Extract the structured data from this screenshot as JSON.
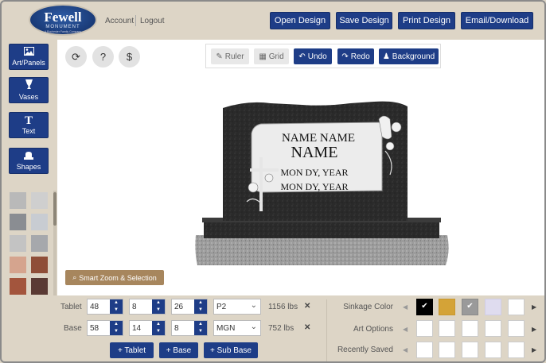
{
  "header": {
    "logo": {
      "line1": "Fewell",
      "line2": "MONUMENT",
      "line3": "A Rochester Family Company"
    },
    "links": {
      "account": "Account",
      "logout": "Logout"
    },
    "buttons": {
      "open": "Open Design",
      "save": "Save Design",
      "print": "Print Design",
      "email": "Email/Download"
    }
  },
  "leftbar": {
    "tools": [
      {
        "label": "Art/Panels",
        "icon": "image-icon"
      },
      {
        "label": "Vases",
        "icon": "vase-icon"
      },
      {
        "label": "Text",
        "icon": "text-icon"
      },
      {
        "label": "Shapes",
        "icon": "shapes-icon"
      }
    ],
    "swatch_colors": [
      "#b9b9b9",
      "#cfcfcf",
      "#8a8d92",
      "#c8ccd2",
      "#c3c3c3",
      "#a6a8ac",
      "#b56b54",
      "#8f4e38",
      "#a3553d",
      "#5a4a44"
    ]
  },
  "canvas": {
    "circle_buttons": {
      "refresh": "⟳",
      "help": "?",
      "price": "$"
    },
    "toolbar": {
      "ruler": "Ruler",
      "grid": "Grid",
      "undo": "Undo",
      "redo": "Redo",
      "background": "Background"
    },
    "monument": {
      "name1": "NAME NAME",
      "name2": "NAME",
      "date1": "MON DY, YEAR",
      "date2": "MON DY, YEAR"
    },
    "smart_zoom": "Smart Zoom & Selection"
  },
  "bottom": {
    "tablet": {
      "label": "Tablet",
      "w": "48",
      "d": "8",
      "h": "26",
      "material": "P2",
      "weight": "1156 lbs"
    },
    "base": {
      "label": "Base",
      "w": "58",
      "d": "14",
      "h": "8",
      "material": "MGN",
      "weight": "752 lbs"
    },
    "buttons": {
      "add_tablet": "+ Tablet",
      "add_base": "+ Base",
      "add_sub_base": "+ Sub Base"
    },
    "right": {
      "sinkage": "Sinkage Color",
      "art_options": "Art Options",
      "recently_saved": "Recently Saved"
    },
    "colors": {
      "accent": "#1e3d87",
      "sinkage_black": "#000000",
      "sinkage_gold": "#d4a337",
      "sinkage_gray": "#9a9a9a",
      "sinkage_lavender": "#dfdcef"
    }
  }
}
